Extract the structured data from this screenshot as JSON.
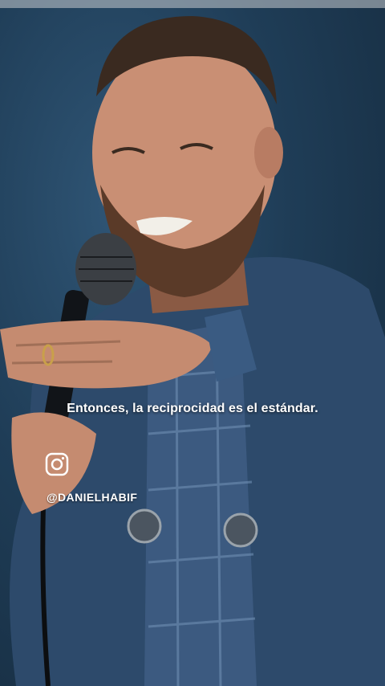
{
  "video": {
    "caption": "Entonces, la reciprocidad es el estándar.",
    "social_icon": "instagram-icon",
    "handle": "@DANIELHABIF"
  },
  "colors": {
    "background": "#1f3d57",
    "jacket": "#2d4a6b",
    "shirt": "#3c5a80",
    "skin": "#c98f74",
    "hair": "#3a2a20",
    "text": "#ffffff"
  }
}
